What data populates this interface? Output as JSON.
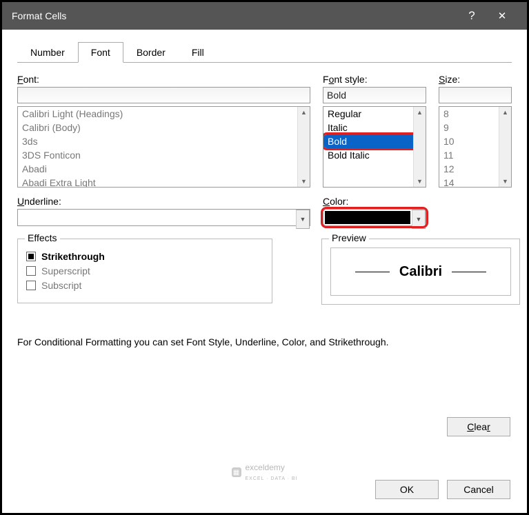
{
  "title": "Format Cells",
  "tabs": [
    "Number",
    "Font",
    "Border",
    "Fill"
  ],
  "active_tab": "Font",
  "font": {
    "label": "Font:",
    "value": "",
    "list": [
      "Calibri Light (Headings)",
      "Calibri (Body)",
      "3ds",
      "3DS Fonticon",
      "Abadi",
      "Abadi Extra Light"
    ]
  },
  "style": {
    "label": "Font style:",
    "value": "Bold",
    "list": [
      "Regular",
      "Italic",
      "Bold",
      "Bold Italic"
    ],
    "selected": "Bold"
  },
  "size": {
    "label": "Size:",
    "value": "",
    "list": [
      "8",
      "9",
      "10",
      "11",
      "12",
      "14"
    ]
  },
  "underline": {
    "label": "Underline:",
    "value": ""
  },
  "color": {
    "label": "Color:",
    "value": "#000000"
  },
  "effects": {
    "legend": "Effects",
    "strikethrough": {
      "label": "Strikethrough",
      "checked": true
    },
    "superscript": {
      "label": "Superscript",
      "checked": false
    },
    "subscript": {
      "label": "Subscript",
      "checked": false
    }
  },
  "preview": {
    "legend": "Preview",
    "text": "Calibri"
  },
  "note": "For Conditional Formatting you can set Font Style, Underline, Color, and Strikethrough.",
  "buttons": {
    "clear": "Clear",
    "ok": "OK",
    "cancel": "Cancel"
  },
  "watermark": "exceldemy",
  "watermark_tag": "EXCEL · DATA · BI"
}
